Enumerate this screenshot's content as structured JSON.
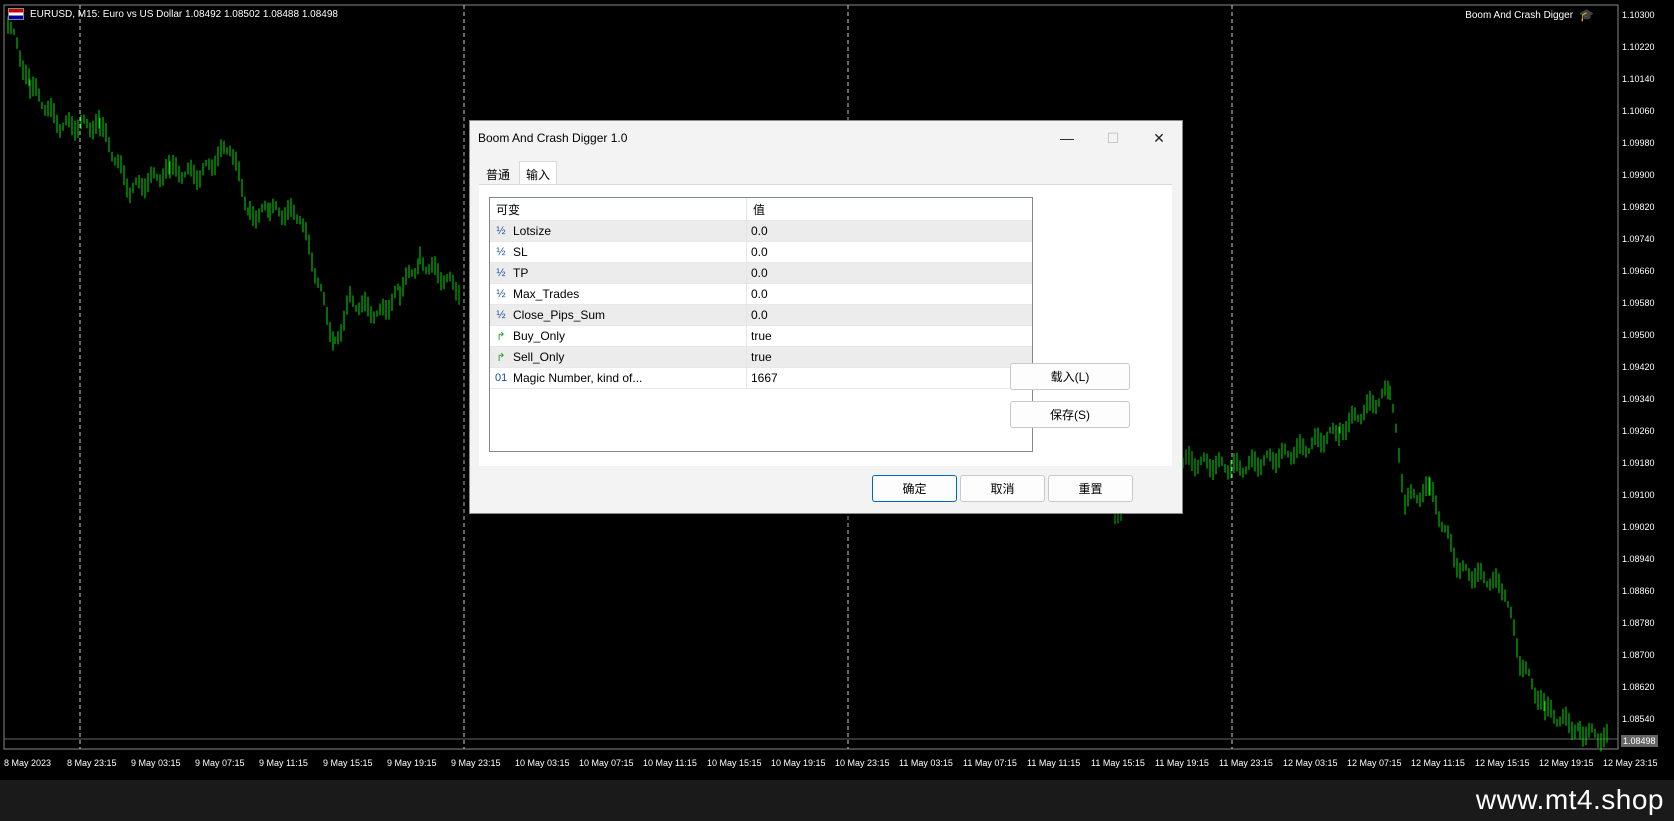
{
  "chart": {
    "symbol_info": "EURUSD, M15:  Euro vs US Dollar  1.08492 1.08502 1.08488 1.08498",
    "ea_name": "Boom And Crash Digger",
    "current_price": "1.08498",
    "price_labels": [
      "1.10300",
      "1.10220",
      "1.10140",
      "1.10060",
      "1.09980",
      "1.09900",
      "1.09820",
      "1.09740",
      "1.09660",
      "1.09580",
      "1.09500",
      "1.09420",
      "1.09340",
      "1.09260",
      "1.09180",
      "1.09100",
      "1.09020",
      "1.08940",
      "1.08860",
      "1.08780",
      "1.08700",
      "1.08620",
      "1.08540"
    ],
    "time_labels": [
      "8 May 2023",
      "8 May 23:15",
      "9 May 03:15",
      "9 May 07:15",
      "9 May 11:15",
      "9 May 15:15",
      "9 May 19:15",
      "9 May 23:15",
      "10 May 03:15",
      "10 May 07:15",
      "10 May 11:15",
      "10 May 15:15",
      "10 May 19:15",
      "10 May 23:15",
      "11 May 03:15",
      "11 May 07:15",
      "11 May 11:15",
      "11 May 15:15",
      "11 May 19:15",
      "11 May 23:15",
      "12 May 03:15",
      "12 May 07:15",
      "12 May 11:15",
      "12 May 15:15",
      "12 May 19:15",
      "12 May 23:15"
    ],
    "candle_color": "#00e000"
  },
  "dialog": {
    "title": "Boom And Crash Digger 1.0",
    "tabs": [
      {
        "label": "普通"
      },
      {
        "label": "输入"
      }
    ],
    "grid_headers": {
      "variable": "可变",
      "value": "值"
    },
    "rows": [
      {
        "icon": "½",
        "name": "Lotsize",
        "value": "0.0"
      },
      {
        "icon": "½",
        "name": "SL",
        "value": "0.0"
      },
      {
        "icon": "½",
        "name": "TP",
        "value": "0.0"
      },
      {
        "icon": "½",
        "name": "Max_Trades",
        "value": "0.0"
      },
      {
        "icon": "½",
        "name": "Close_Pips_Sum",
        "value": "0.0"
      },
      {
        "icon": "↱",
        "name": "Buy_Only",
        "value": "true"
      },
      {
        "icon": "↱",
        "name": "Sell_Only",
        "value": "true"
      },
      {
        "icon": "01",
        "name": "Magic Number, kind of...",
        "value": "1667"
      }
    ],
    "load_button": "载入(L)",
    "save_button": "保存(S)",
    "ok_button": "确定",
    "cancel_button": "取消",
    "reset_button": "重置"
  },
  "footer": {
    "watermark": "www.mt4.shop"
  }
}
